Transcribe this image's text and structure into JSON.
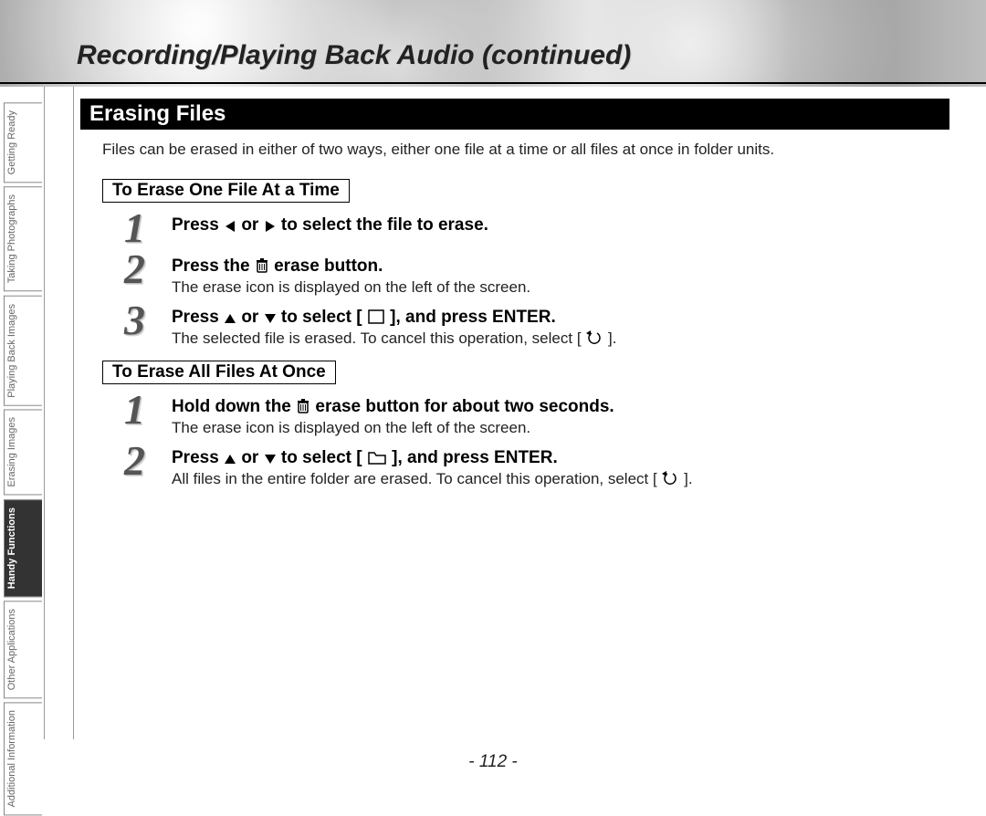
{
  "header": {
    "title": "Recording/Playing Back Audio (continued)"
  },
  "sidebar": {
    "tabs": [
      {
        "label": "Getting Ready",
        "active": false
      },
      {
        "label": "Taking Photographs",
        "active": false
      },
      {
        "label": "Playing Back Images",
        "active": false
      },
      {
        "label": "Erasing Images",
        "active": false
      },
      {
        "label": "Handy Functions",
        "active": true
      },
      {
        "label": "Other Applications",
        "active": false
      },
      {
        "label": "Additional Information",
        "active": false
      }
    ]
  },
  "section": {
    "banner": "Erasing Files",
    "intro": "Files can be erased in either of two ways, either one file at a time or all files at once in folder units.",
    "blocks": [
      {
        "subheading": "To Erase One File At a Time",
        "steps": [
          {
            "num": "1",
            "instruction_parts": [
              "Press ",
              "LEFT_TRI",
              " or ",
              "RIGHT_TRI",
              " to select the file to erase."
            ],
            "note_parts": []
          },
          {
            "num": "2",
            "instruction_parts": [
              "Press the ",
              "TRASH",
              " erase button."
            ],
            "note_parts": [
              "The erase icon is displayed on the left of the screen."
            ]
          },
          {
            "num": "3",
            "instruction_parts": [
              "Press ",
              "UP_TRI",
              " or ",
              "DOWN_TRI",
              " to select [ ",
              "SQUARE",
              " ], and press ENTER."
            ],
            "note_parts": [
              "The selected file is erased. To cancel this operation, select [ ",
              "CANCEL",
              " ]."
            ]
          }
        ]
      },
      {
        "subheading": "To Erase All Files At Once",
        "steps": [
          {
            "num": "1",
            "instruction_parts": [
              "Hold down the ",
              "TRASH",
              " erase button for about two seconds."
            ],
            "note_parts": [
              "The erase icon is displayed on the left of the screen."
            ]
          },
          {
            "num": "2",
            "instruction_parts": [
              "Press ",
              "UP_TRI",
              " or ",
              "DOWN_TRI",
              " to select [ ",
              "FOLDER",
              " ], and press ENTER."
            ],
            "note_parts": [
              "All files in the entire folder are erased. To cancel this operation, select [ ",
              "CANCEL",
              " ]."
            ]
          }
        ]
      }
    ]
  },
  "page_number": "- 112 -"
}
